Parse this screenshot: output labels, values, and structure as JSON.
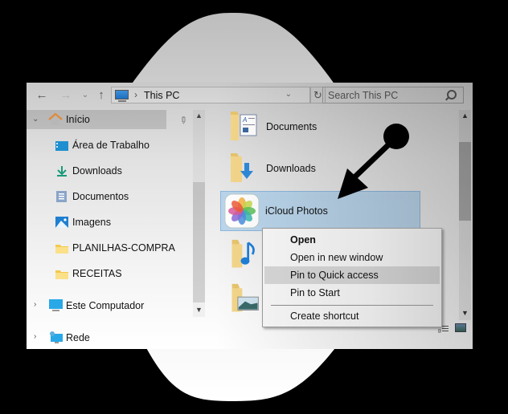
{
  "toolbar": {
    "back_icon": "arrow-left-icon",
    "forward_icon": "arrow-right-icon",
    "recent_icon": "chevron-down-icon",
    "up_icon": "arrow-up-icon",
    "address": {
      "location_icon": "this-pc-icon",
      "separator": "›",
      "path": "This PC",
      "dropdown_icon": "chevron-down-icon"
    },
    "refresh_icon": "refresh-icon",
    "search": {
      "placeholder": "Search This PC",
      "value": "",
      "icon": "search-icon"
    }
  },
  "nav_pane": {
    "items": [
      {
        "label": "Início",
        "icon": "home-icon",
        "expanded": true,
        "selected": true,
        "pinned_icon": "pin-icon"
      },
      {
        "label": "Área de Trabalho",
        "icon": "desktop-icon"
      },
      {
        "label": "Downloads",
        "icon": "download-icon"
      },
      {
        "label": "Documentos",
        "icon": "document-icon"
      },
      {
        "label": "Imagens",
        "icon": "pictures-icon"
      },
      {
        "label": "PLANILHAS-COMPRA",
        "icon": "folder-icon"
      },
      {
        "label": "RECEITAS",
        "icon": "folder-icon"
      },
      {
        "label": "Este Computador",
        "icon": "computer-icon",
        "expanded": false
      },
      {
        "label": "Rede",
        "icon": "network-icon",
        "expanded": false
      }
    ]
  },
  "content": {
    "items": [
      {
        "label": "Documents",
        "icon": "documents-folder-icon"
      },
      {
        "label": "Downloads",
        "icon": "downloads-folder-icon"
      },
      {
        "label": "iCloud Photos",
        "icon": "icloud-photos-icon",
        "selected": true
      },
      {
        "label": "",
        "icon": "music-folder-icon"
      },
      {
        "label": "",
        "icon": "pictures-folder-icon"
      }
    ]
  },
  "context_menu": {
    "items": [
      {
        "label": "Open",
        "bold": true
      },
      {
        "label": "Open in new window"
      },
      {
        "label": "Pin to Quick access",
        "highlighted": true
      },
      {
        "label": "Pin to Start"
      },
      {
        "label": "Create shortcut"
      }
    ]
  },
  "view_buttons": {
    "details": "details-view-icon",
    "tiles": "large-icons-view-icon"
  },
  "colors": {
    "selection_fill": "#aacdeb",
    "selection_border": "#8db7dd",
    "menu_highlight": "#cfcfcf",
    "annotation": "#000000"
  }
}
